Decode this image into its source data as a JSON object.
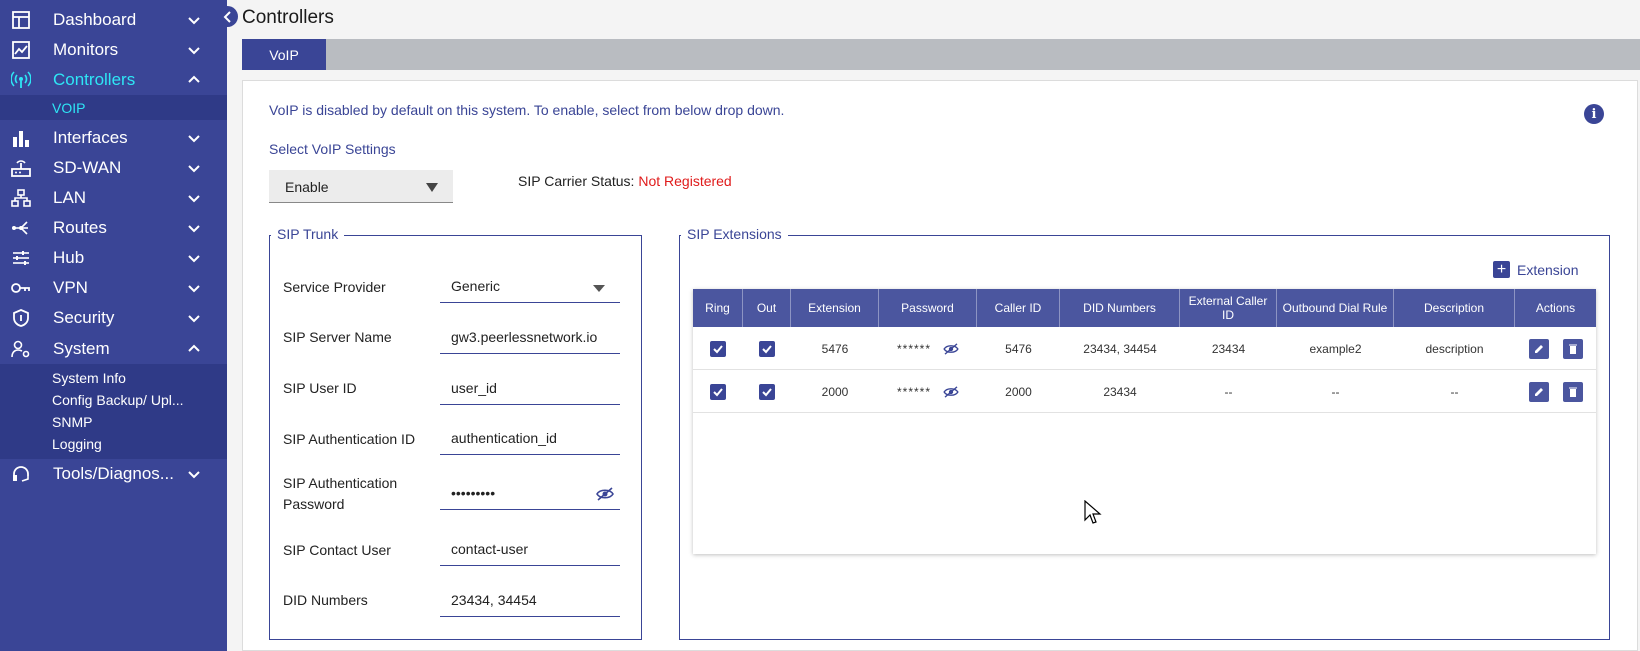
{
  "sidebar": {
    "items": [
      {
        "label": "Dashboard",
        "icon": "dashboard-icon"
      },
      {
        "label": "Monitors",
        "icon": "monitor-chart-icon"
      },
      {
        "label": "Controllers",
        "icon": "antenna-icon"
      },
      {
        "label": "Interfaces",
        "icon": "bar-chart-icon"
      },
      {
        "label": "SD-WAN",
        "icon": "router-icon"
      },
      {
        "label": "LAN",
        "icon": "network-tree-icon"
      },
      {
        "label": "Routes",
        "icon": "routes-icon"
      },
      {
        "label": "Hub",
        "icon": "sliders-icon"
      },
      {
        "label": "VPN",
        "icon": "key-icon"
      },
      {
        "label": "Security",
        "icon": "shield-icon"
      },
      {
        "label": "System",
        "icon": "user-gear-icon"
      },
      {
        "label": "Tools/Diagnos...",
        "icon": "headset-icon"
      }
    ],
    "controllers_sub": [
      "VOIP"
    ],
    "system_sub": [
      "System Info",
      "Config Backup/ Upl...",
      "SNMP",
      "Logging"
    ],
    "accent_color": "#2ee6f5",
    "bg_color": "#3a4596"
  },
  "page": {
    "title": "Controllers",
    "tab": "VoIP",
    "info_message": "VoIP is disabled by default on this system. To enable, select from below drop down.",
    "select_label": "Select VoIP Settings",
    "select_value": "Enable",
    "carrier_status_label": "SIP Carrier Status:",
    "carrier_status_value": "Not Registered"
  },
  "sip_trunk": {
    "legend": "SIP Trunk",
    "fields": [
      {
        "label": "Service Provider",
        "value": "Generic"
      },
      {
        "label": "SIP Server Name",
        "value": "gw3.peerlessnetwork.io"
      },
      {
        "label": "SIP User ID",
        "value": "user_id"
      },
      {
        "label": "SIP Authentication ID",
        "value": "authentication_id"
      },
      {
        "label": "SIP Authentication Password",
        "value": "•••••••••"
      },
      {
        "label": "SIP Contact User",
        "value": "contact-user"
      },
      {
        "label": "DID Numbers",
        "value": "23434, 34454"
      }
    ]
  },
  "sip_extensions": {
    "legend": "SIP Extensions",
    "add_label": "Extension",
    "columns": [
      "Ring",
      "Out",
      "Extension",
      "Password",
      "Caller ID",
      "DID Numbers",
      "External Caller ID",
      "Outbound Dial Rule",
      "Description",
      "Actions"
    ],
    "rows": [
      {
        "ring": true,
        "out": true,
        "extension": "5476",
        "password": "******",
        "caller_id": "5476",
        "did": "23434, 34454",
        "ext_caller_id": "23434",
        "dial_rule": "example2",
        "description": "description"
      },
      {
        "ring": true,
        "out": true,
        "extension": "2000",
        "password": "******",
        "caller_id": "2000",
        "did": "23434",
        "ext_caller_id": "--",
        "dial_rule": "--",
        "description": "--"
      }
    ]
  }
}
